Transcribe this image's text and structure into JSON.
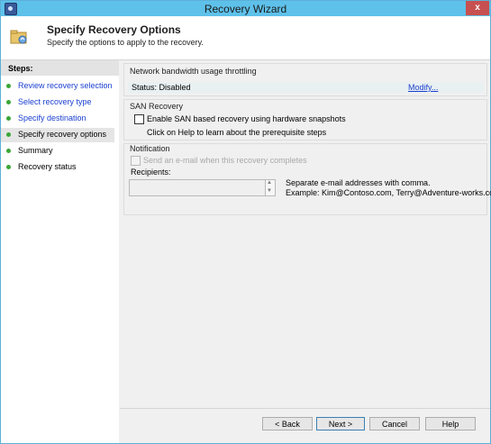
{
  "window": {
    "title": "Recovery Wizard",
    "close_glyph": "x"
  },
  "header": {
    "title": "Specify Recovery Options",
    "subtitle": "Specify the options to apply to the recovery."
  },
  "steps": {
    "title": "Steps:",
    "items": [
      {
        "label": "Review recovery selection",
        "link": true
      },
      {
        "label": "Select recovery type",
        "link": true
      },
      {
        "label": "Specify destination",
        "link": true
      },
      {
        "label": "Specify recovery options",
        "link": false,
        "active": true
      },
      {
        "label": "Summary",
        "link": false
      },
      {
        "label": "Recovery status",
        "link": false
      }
    ]
  },
  "bandwidth": {
    "label": "Network bandwidth usage throttling",
    "status": "Status: Disabled",
    "modify_link": "Modify..."
  },
  "san": {
    "label": "SAN Recovery",
    "checkbox_label": "Enable SAN based recovery using hardware snapshots",
    "help_text": "Click on Help to learn about the prerequisite steps",
    "checked": false
  },
  "notification": {
    "label": "Notification",
    "email_checkbox_label": "Send an e-mail when this recovery completes",
    "recipients_label": "Recipients:",
    "recipients_value": "",
    "hint_line1": "Separate e-mail addresses with comma.",
    "hint_line2": "Example: Kim@Contoso.com, Terry@Adventure-works.com"
  },
  "buttons": {
    "back": "< Back",
    "next": "Next >",
    "cancel": "Cancel",
    "help": "Help"
  },
  "colors": {
    "titlebar": "#5ec1ea",
    "close": "#c75050",
    "link": "#1a3fcf",
    "step_dot": "#3aa635"
  }
}
